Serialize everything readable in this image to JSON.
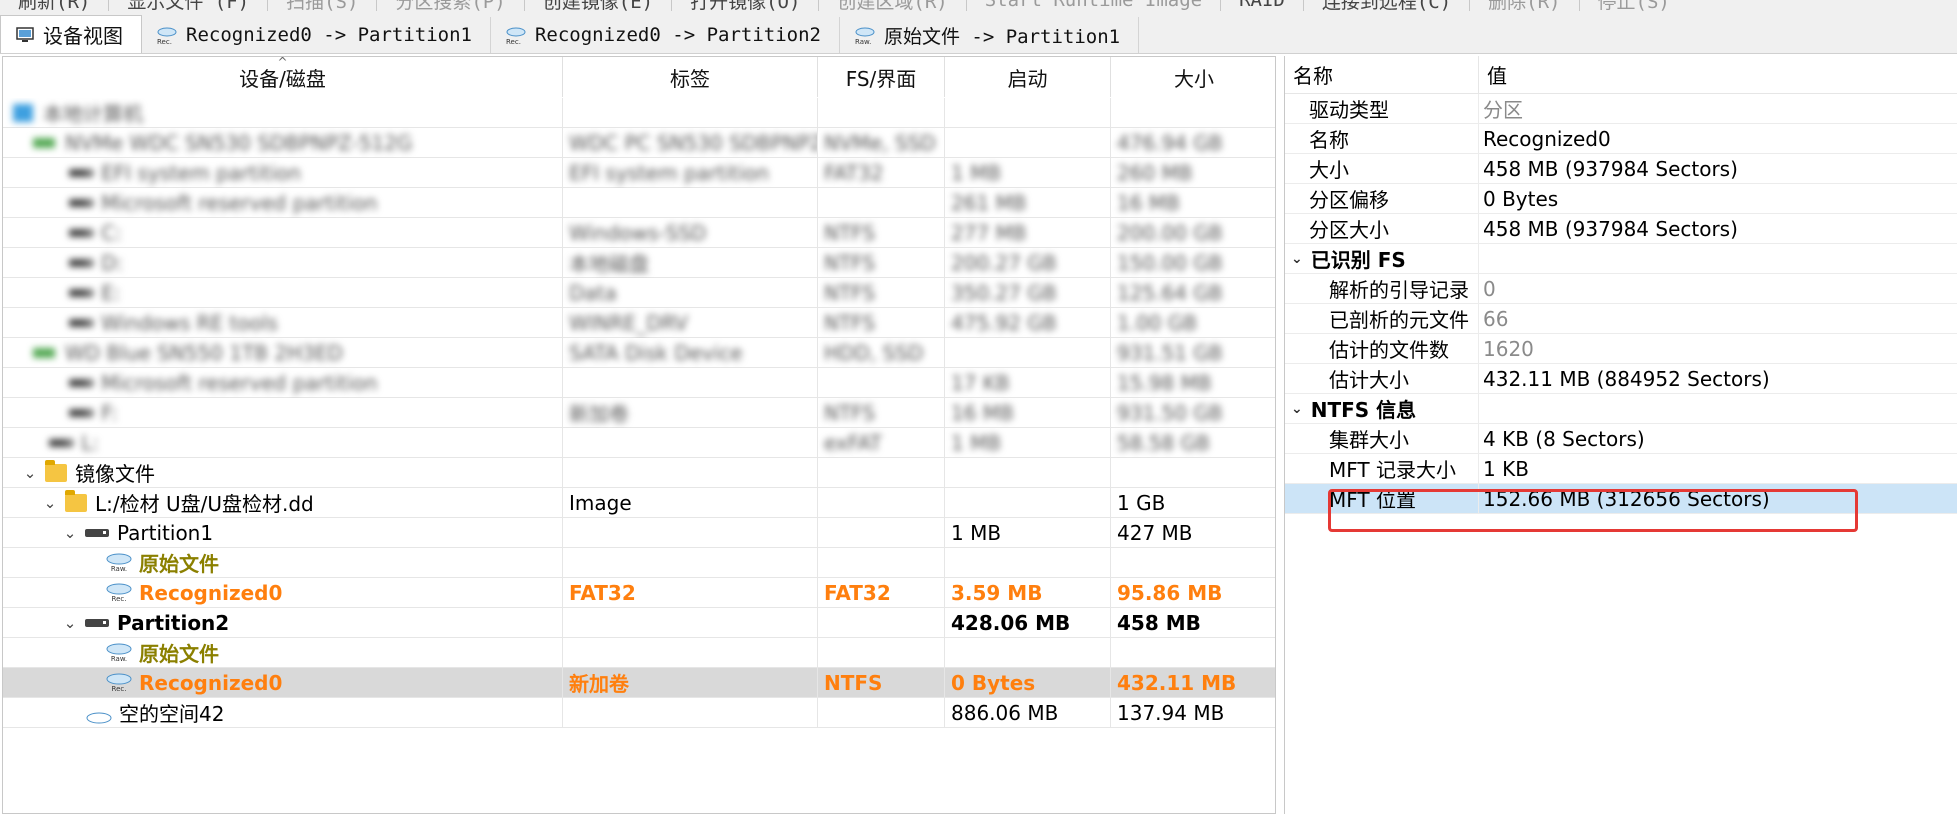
{
  "menu": [
    {
      "label": "刷新(R)",
      "dim": false
    },
    {
      "label": "显示文件 (F)",
      "dim": false
    },
    {
      "label": "扫描(S)",
      "dim": true
    },
    {
      "label": "分区搜索(P)",
      "dim": true
    },
    {
      "label": "创建镜像(E)",
      "dim": false
    },
    {
      "label": "打开镜像(O)",
      "dim": false
    },
    {
      "label": "创建区域(R)",
      "dim": true
    },
    {
      "label": "Start Runtime Image",
      "dim": true
    },
    {
      "label": "RAID",
      "dim": false
    },
    {
      "label": "连接到远程(C)",
      "dim": false
    },
    {
      "label": "删除(R)",
      "dim": true
    },
    {
      "label": "停止(S)",
      "dim": true
    }
  ],
  "tabs": [
    {
      "label": "设备视图",
      "icon": "monitor-icon",
      "active": true
    },
    {
      "label": "Recognized0 -> Partition1",
      "icon": "rec-partition-icon",
      "active": false
    },
    {
      "label": "Recognized0 -> Partition2",
      "icon": "rec-partition-icon",
      "active": false
    },
    {
      "label": "原始文件 -> Partition1",
      "icon": "raw-partition-icon",
      "active": false
    }
  ],
  "left_table": {
    "columns": [
      "设备/磁盘",
      "标签",
      "FS/界面",
      "启动",
      "大小"
    ],
    "blurred_rows": [
      {
        "indent": 0,
        "cells": [
          "本地计算机",
          "",
          "",
          "",
          ""
        ]
      },
      {
        "indent": 1,
        "cells": [
          "NVMe WDC SN530 SDBPNPZ-512G",
          "WDC PC SN530 SDBPNPZ",
          "NVMe, SSD",
          "",
          "476.94 GB"
        ]
      },
      {
        "indent": 2,
        "cells": [
          "EFI system partition",
          "EFI system partition",
          "FAT32",
          "1 MB",
          "260 MB"
        ]
      },
      {
        "indent": 2,
        "cells": [
          "Microsoft reserved partition",
          "",
          "",
          "261 MB",
          "16 MB"
        ]
      },
      {
        "indent": 2,
        "cells": [
          "C:",
          "Windows-SSD",
          "NTFS",
          "277 MB",
          "200.00 GB"
        ]
      },
      {
        "indent": 2,
        "cells": [
          "D:",
          "本地磁盘",
          "NTFS",
          "200.27 GB",
          "150.00 GB"
        ]
      },
      {
        "indent": 2,
        "cells": [
          "E:",
          "Data",
          "NTFS",
          "350.27 GB",
          "125.64 GB"
        ]
      },
      {
        "indent": 2,
        "cells": [
          "Windows RE tools",
          "WINRE_DRV",
          "NTFS",
          "475.92 GB",
          "1.00 GB"
        ]
      },
      {
        "indent": 1,
        "cells": [
          "WD Blue SN550 1TB 2H3ED",
          "SATA Disk Device",
          "HDD, SSD",
          "",
          "931.51 GB"
        ]
      },
      {
        "indent": 2,
        "cells": [
          "Microsoft reserved partition",
          "",
          "",
          "17 KB",
          "15.98 MB"
        ]
      },
      {
        "indent": 2,
        "cells": [
          "F:",
          "新加卷",
          "NTFS",
          "16 MB",
          "931.50 GB"
        ]
      },
      {
        "indent": 1,
        "cells": [
          "L:",
          "",
          "exFAT",
          "1 MB",
          "58.58 GB"
        ]
      }
    ],
    "rows": [
      {
        "name": "镜像文件",
        "label": "",
        "fs": "",
        "start": "",
        "size": "",
        "style": "normal"
      },
      {
        "name": "L:/检材 U盘/U盘检材.dd",
        "label": "Image",
        "fs": "",
        "start": "",
        "size": "1 GB",
        "style": "normal"
      },
      {
        "name": "Partition1",
        "label": "",
        "fs": "",
        "start": "1 MB",
        "size": "427 MB",
        "style": "normal"
      },
      {
        "name": "原始文件",
        "label": "",
        "fs": "",
        "start": "",
        "size": "",
        "style": "olive"
      },
      {
        "name": "Recognized0",
        "label": "FAT32",
        "fs": "FAT32",
        "start": "3.59 MB",
        "size": "95.86 MB",
        "style": "orange"
      },
      {
        "name": "Partition2",
        "label": "",
        "fs": "",
        "start": "428.06 MB",
        "size": "458 MB",
        "style": "bold"
      },
      {
        "name": "原始文件",
        "label": "",
        "fs": "",
        "start": "",
        "size": "",
        "style": "olive"
      },
      {
        "name": "Recognized0",
        "label": "新加卷",
        "fs": "NTFS",
        "start": "0 Bytes",
        "size": "432.11 MB",
        "style": "orange"
      },
      {
        "name": "空的空间42",
        "label": "",
        "fs": "",
        "start": "886.06 MB",
        "size": "137.94 MB",
        "style": "normal"
      }
    ]
  },
  "properties": {
    "col_name": "名称",
    "col_value": "值",
    "rows": [
      {
        "key": "驱动类型",
        "value": "分区",
        "gray": true
      },
      {
        "key": "名称",
        "value": "Recognized0",
        "gray": false
      },
      {
        "key": "大小",
        "value": "458 MB (937984 Sectors)",
        "gray": false
      },
      {
        "key": "分区偏移",
        "value": "0 Bytes",
        "gray": false
      },
      {
        "key": "分区大小",
        "value": "458 MB (937984 Sectors)",
        "gray": false
      }
    ],
    "group1": {
      "title": "已识别 FS",
      "rows": [
        {
          "key": "解析的引导记录",
          "value": "0",
          "gray": true
        },
        {
          "key": "已剖析的元文件",
          "value": "66",
          "gray": true
        },
        {
          "key": "估计的文件数",
          "value": "1620",
          "gray": true
        },
        {
          "key": "估计大小",
          "value": "432.11 MB (884952 Sectors)",
          "gray": false
        }
      ]
    },
    "group2": {
      "title": "NTFS 信息",
      "rows": [
        {
          "key": "集群大小",
          "value": "4 KB (8 Sectors)",
          "gray": false
        },
        {
          "key": "MFT 记录大小",
          "value": "1 KB",
          "gray": false
        },
        {
          "key": "MFT 位置",
          "value": "152.66 MB (312656 Sectors)",
          "gray": false
        }
      ]
    }
  },
  "colors": {
    "orange": "#ff7f0e",
    "olive": "#8b8000",
    "selection_gray": "#d9d9d9",
    "selection_blue": "#cce4f7",
    "highlight_red": "#e53935"
  }
}
